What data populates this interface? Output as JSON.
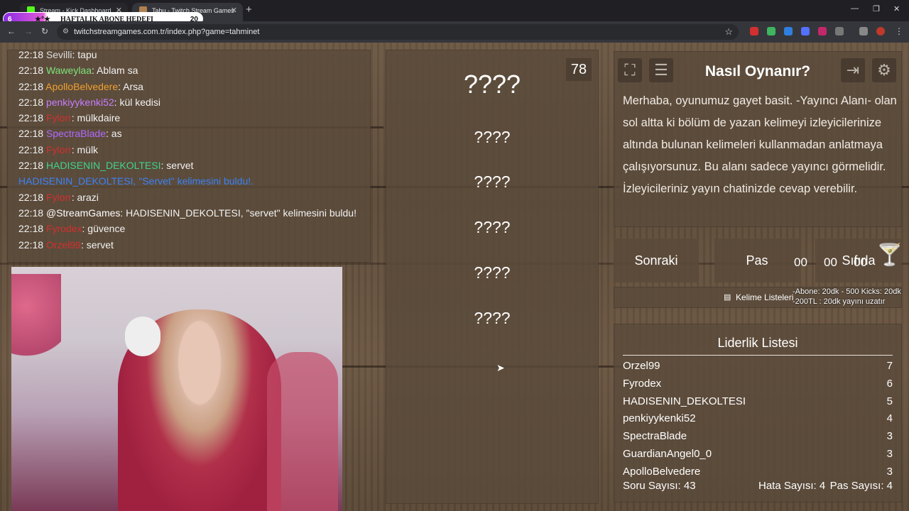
{
  "browser": {
    "tabs": [
      {
        "title": "Stream - Kick Dashboard",
        "fav_color": "#53fc18"
      },
      {
        "title": "Tabu - Twitch Stream Games",
        "fav_color": "#b08050"
      }
    ],
    "url": "twitchstreamgames.com.tr/index.php?game=tahminet",
    "overlay": {
      "number": "6",
      "label": "HAFTALIK ABONE HEDEFI",
      "deco": "★°★",
      "count": "20"
    }
  },
  "chat": {
    "lines": [
      {
        "time": "22:18",
        "user": "Sevilli",
        "color": "#ddd",
        "msg": ": tapu"
      },
      {
        "time": "22:18",
        "user": "Waweylaa",
        "color": "#7ee37a",
        "msg": ": Ablam sa"
      },
      {
        "time": "22:18",
        "user": "ApolloBelvedere",
        "color": "#f0a030",
        "msg": ": Arsa"
      },
      {
        "time": "22:18",
        "user": "penkiyykenki52",
        "color": "#c77dff",
        "msg": ": kül kedisi"
      },
      {
        "time": "22:18",
        "user": "Fylorr",
        "color": "#d23030",
        "msg": ": mülkdaire"
      },
      {
        "time": "22:18",
        "user": "SpectraBlade",
        "color": "#b069ff",
        "msg": ": as"
      },
      {
        "time": "22:18",
        "user": "Fylorr",
        "color": "#d23030",
        "msg": ": mülk"
      },
      {
        "time": "22:18",
        "user": "HADISENIN_DEKOLTESI",
        "color": "#3fd38e",
        "msg": ": servet"
      },
      {
        "time": "",
        "user": "HADISENIN_DEKOLTESI, ",
        "color": "#3b82f6",
        "msg": "\"Servet\" kelimesini buldu!."
      },
      {
        "time": "22:18",
        "user": "Fylorr",
        "color": "#d23030",
        "msg": ": arazi"
      },
      {
        "time": "22:18",
        "user": "@StreamGames",
        "color": "#ffffff",
        "msg": ": HADISENIN_DEKOLTESI, \"servet\" kelimesini buldu!"
      },
      {
        "time": "22:18",
        "user": "Fyrodex",
        "color": "#d23030",
        "msg": ": güvence"
      },
      {
        "time": "22:18",
        "user": "Orzel99",
        "color": "#d23030",
        "msg": ": servet"
      }
    ]
  },
  "words": {
    "main": "????",
    "forbidden": [
      "????",
      "????",
      "????",
      "????",
      "????"
    ],
    "counter": "78"
  },
  "how": {
    "title": "Nasıl Oynanır?",
    "body": "Merhaba, oyunumuz gayet basit. -Yayıncı Alanı- olan sol altta ki bölüm de yazan kelimeyi izleyicilerinize altında bulunan kelimeleri kullanmadan anlatmaya çalışıyorsunuz. Bu alanı sadece yayıncı görmelidir. İzleyicileriniz yayın chatinizde cevap verebilir."
  },
  "buttons": {
    "next": "Sonraki",
    "pass": "Pas",
    "reset": "Sıfırla"
  },
  "timers": [
    "00",
    "00",
    "00"
  ],
  "word_list_label": "Kelime Listeleri",
  "notes": [
    "-Abone: 20dk - 500 Kicks: 20dk",
    "-200TL : 20dk yayını uzatır"
  ],
  "leaderboard": {
    "title": "Liderlik Listesi",
    "rows": [
      {
        "name": "Orzel99",
        "score": "7"
      },
      {
        "name": "Fyrodex",
        "score": "6"
      },
      {
        "name": "HADISENIN_DEKOLTESI",
        "score": "5"
      },
      {
        "name": "penkiyykenki52",
        "score": "4"
      },
      {
        "name": "SpectraBlade",
        "score": "3"
      },
      {
        "name": "GuardianAngel0_0",
        "score": "3"
      },
      {
        "name": "ApolloBelvedere",
        "score": "3"
      }
    ]
  },
  "stats": {
    "questions": "Soru Sayısı: 43",
    "errors": "Hata Sayısı: 4",
    "passes": "Pas Sayısı: 4"
  }
}
